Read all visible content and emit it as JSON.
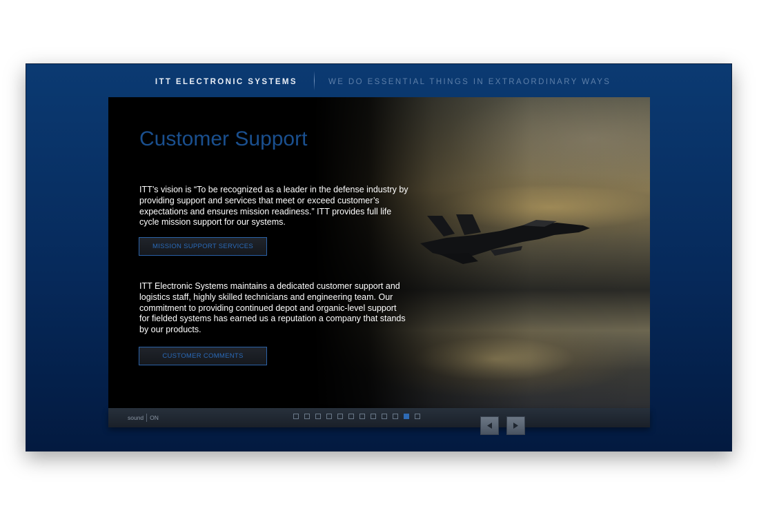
{
  "header": {
    "brand": "ITT ELECTRONIC SYSTEMS",
    "tagline": "WE DO ESSENTIAL THINGS IN EXTRAORDINARY WAYS"
  },
  "main": {
    "title": "Customer Support",
    "paragraph1": "ITT’s vision is “To be recognized as a leader in the defense industry by providing support and services that meet or exceed customer’s expectations and ensures mission readiness.”  ITT provides full life cycle mission support for our systems.",
    "button1": "MISSION SUPPORT SERVICES",
    "paragraph2": "ITT Electronic Systems maintains a dedicated customer support and logistics staff, highly skilled technicians and engineering team.  Our commitment to providing continued depot and organic-level support for fielded systems has earned us a reputation a company that stands by our products.",
    "button2": "CUSTOMER COMMENTS"
  },
  "footer": {
    "sound_label": "sound",
    "sound_state": "ON",
    "page_count": 12,
    "active_page": 11,
    "prev_icon": "left-triangle",
    "next_icon": "right-triangle"
  },
  "colors": {
    "frame_background": "#06295a",
    "title_blue": "#1a4f8e",
    "button_border": "#2b62a8",
    "active_dot": "#2e6ab4"
  }
}
